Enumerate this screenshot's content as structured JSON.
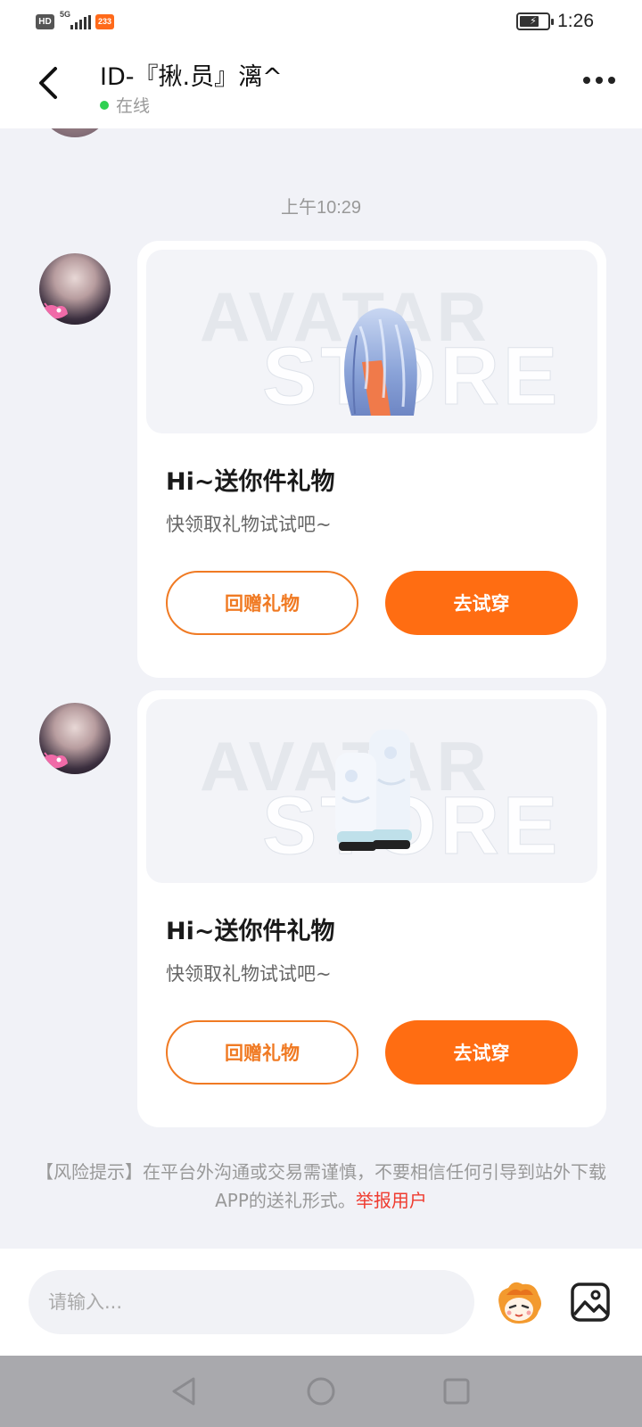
{
  "status_bar": {
    "hd": "HD",
    "network": "5G",
    "app_badge": "233",
    "time": "1:26",
    "battery_level": 0.7,
    "charging": true
  },
  "header": {
    "title": "ID-『揪.员』漓^",
    "status": "在线",
    "status_color": "#2fd152"
  },
  "chat": {
    "timestamp": "上午10:29",
    "watermark_line1": "AVATAR",
    "watermark_line2": "STORE",
    "messages": [
      {
        "title": "Hi~送你件礼物",
        "subtitle": "快领取礼物试试吧~",
        "secondary_button": "回赠礼物",
        "primary_button": "去试穿",
        "gift": "hair"
      },
      {
        "title": "Hi~送你件礼物",
        "subtitle": "快领取礼物试试吧~",
        "secondary_button": "回赠礼物",
        "primary_button": "去试穿",
        "gift": "boots"
      }
    ],
    "risk_notice": "【风险提示】在平台外沟通或交易需谨慎，不要相信任何引导到站外下载APP的送礼形式。",
    "report_link": "举报用户"
  },
  "input": {
    "placeholder": "请输入..."
  },
  "colors": {
    "accent": "#ff6d12",
    "link_red": "#ef3b2f"
  },
  "icons": {
    "back": "chevron-left-icon",
    "more": "more-icon",
    "emoji": "emoji-mascot-icon",
    "image": "image-icon",
    "nav_back": "nav-back-icon",
    "nav_home": "nav-home-icon",
    "nav_recent": "nav-recent-icon"
  }
}
